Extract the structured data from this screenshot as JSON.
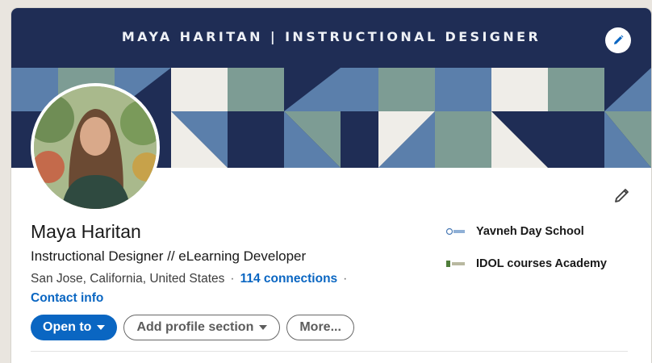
{
  "banner": {
    "title": "MAYA HARITAN  |  INSTRUCTIONAL DESIGNER",
    "colors": {
      "navy": "#1f2d55",
      "steel": "#5b7fab",
      "sage": "#7d9c94",
      "cream": "#efede8"
    }
  },
  "profile": {
    "name": "Maya Haritan",
    "headline": "Instructional Designer // eLearning Developer",
    "location": "San Jose, California, United States",
    "separator": "·",
    "connections": "114 connections",
    "contact_info": "Contact info"
  },
  "actions": {
    "open_to": "Open to",
    "add_profile_section": "Add profile section",
    "more": "More..."
  },
  "experience": [
    {
      "name": "Yavneh Day School",
      "logo_icon": "yavneh-logo-icon"
    },
    {
      "name": "IDOL courses Academy",
      "logo_icon": "idol-logo-icon"
    }
  ],
  "icons": {
    "banner_edit": "pencil-icon",
    "profile_edit": "pencil-icon"
  },
  "accent": "#0a66c2"
}
